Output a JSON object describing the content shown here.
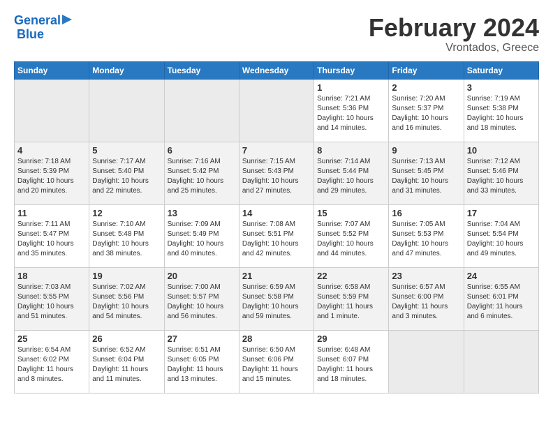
{
  "header": {
    "logo_line1": "General",
    "logo_line2": "Blue",
    "title": "February 2024",
    "subtitle": "Vrontados, Greece"
  },
  "weekdays": [
    "Sunday",
    "Monday",
    "Tuesday",
    "Wednesday",
    "Thursday",
    "Friday",
    "Saturday"
  ],
  "weeks": [
    [
      {
        "num": "",
        "empty": true
      },
      {
        "num": "",
        "empty": true
      },
      {
        "num": "",
        "empty": true
      },
      {
        "num": "",
        "empty": true
      },
      {
        "num": "1",
        "sunrise": "7:21 AM",
        "sunset": "5:36 PM",
        "daylight": "10 hours and 14 minutes."
      },
      {
        "num": "2",
        "sunrise": "7:20 AM",
        "sunset": "5:37 PM",
        "daylight": "10 hours and 16 minutes."
      },
      {
        "num": "3",
        "sunrise": "7:19 AM",
        "sunset": "5:38 PM",
        "daylight": "10 hours and 18 minutes."
      }
    ],
    [
      {
        "num": "4",
        "sunrise": "7:18 AM",
        "sunset": "5:39 PM",
        "daylight": "10 hours and 20 minutes."
      },
      {
        "num": "5",
        "sunrise": "7:17 AM",
        "sunset": "5:40 PM",
        "daylight": "10 hours and 22 minutes."
      },
      {
        "num": "6",
        "sunrise": "7:16 AM",
        "sunset": "5:42 PM",
        "daylight": "10 hours and 25 minutes."
      },
      {
        "num": "7",
        "sunrise": "7:15 AM",
        "sunset": "5:43 PM",
        "daylight": "10 hours and 27 minutes."
      },
      {
        "num": "8",
        "sunrise": "7:14 AM",
        "sunset": "5:44 PM",
        "daylight": "10 hours and 29 minutes."
      },
      {
        "num": "9",
        "sunrise": "7:13 AM",
        "sunset": "5:45 PM",
        "daylight": "10 hours and 31 minutes."
      },
      {
        "num": "10",
        "sunrise": "7:12 AM",
        "sunset": "5:46 PM",
        "daylight": "10 hours and 33 minutes."
      }
    ],
    [
      {
        "num": "11",
        "sunrise": "7:11 AM",
        "sunset": "5:47 PM",
        "daylight": "10 hours and 35 minutes."
      },
      {
        "num": "12",
        "sunrise": "7:10 AM",
        "sunset": "5:48 PM",
        "daylight": "10 hours and 38 minutes."
      },
      {
        "num": "13",
        "sunrise": "7:09 AM",
        "sunset": "5:49 PM",
        "daylight": "10 hours and 40 minutes."
      },
      {
        "num": "14",
        "sunrise": "7:08 AM",
        "sunset": "5:51 PM",
        "daylight": "10 hours and 42 minutes."
      },
      {
        "num": "15",
        "sunrise": "7:07 AM",
        "sunset": "5:52 PM",
        "daylight": "10 hours and 44 minutes."
      },
      {
        "num": "16",
        "sunrise": "7:05 AM",
        "sunset": "5:53 PM",
        "daylight": "10 hours and 47 minutes."
      },
      {
        "num": "17",
        "sunrise": "7:04 AM",
        "sunset": "5:54 PM",
        "daylight": "10 hours and 49 minutes."
      }
    ],
    [
      {
        "num": "18",
        "sunrise": "7:03 AM",
        "sunset": "5:55 PM",
        "daylight": "10 hours and 51 minutes."
      },
      {
        "num": "19",
        "sunrise": "7:02 AM",
        "sunset": "5:56 PM",
        "daylight": "10 hours and 54 minutes."
      },
      {
        "num": "20",
        "sunrise": "7:00 AM",
        "sunset": "5:57 PM",
        "daylight": "10 hours and 56 minutes."
      },
      {
        "num": "21",
        "sunrise": "6:59 AM",
        "sunset": "5:58 PM",
        "daylight": "10 hours and 59 minutes."
      },
      {
        "num": "22",
        "sunrise": "6:58 AM",
        "sunset": "5:59 PM",
        "daylight": "11 hours and 1 minute."
      },
      {
        "num": "23",
        "sunrise": "6:57 AM",
        "sunset": "6:00 PM",
        "daylight": "11 hours and 3 minutes."
      },
      {
        "num": "24",
        "sunrise": "6:55 AM",
        "sunset": "6:01 PM",
        "daylight": "11 hours and 6 minutes."
      }
    ],
    [
      {
        "num": "25",
        "sunrise": "6:54 AM",
        "sunset": "6:02 PM",
        "daylight": "11 hours and 8 minutes."
      },
      {
        "num": "26",
        "sunrise": "6:52 AM",
        "sunset": "6:04 PM",
        "daylight": "11 hours and 11 minutes."
      },
      {
        "num": "27",
        "sunrise": "6:51 AM",
        "sunset": "6:05 PM",
        "daylight": "11 hours and 13 minutes."
      },
      {
        "num": "28",
        "sunrise": "6:50 AM",
        "sunset": "6:06 PM",
        "daylight": "11 hours and 15 minutes."
      },
      {
        "num": "29",
        "sunrise": "6:48 AM",
        "sunset": "6:07 PM",
        "daylight": "11 hours and 18 minutes."
      },
      {
        "num": "",
        "empty": true
      },
      {
        "num": "",
        "empty": true
      }
    ]
  ],
  "labels": {
    "sunrise": "Sunrise:",
    "sunset": "Sunset:",
    "daylight": "Daylight:"
  }
}
